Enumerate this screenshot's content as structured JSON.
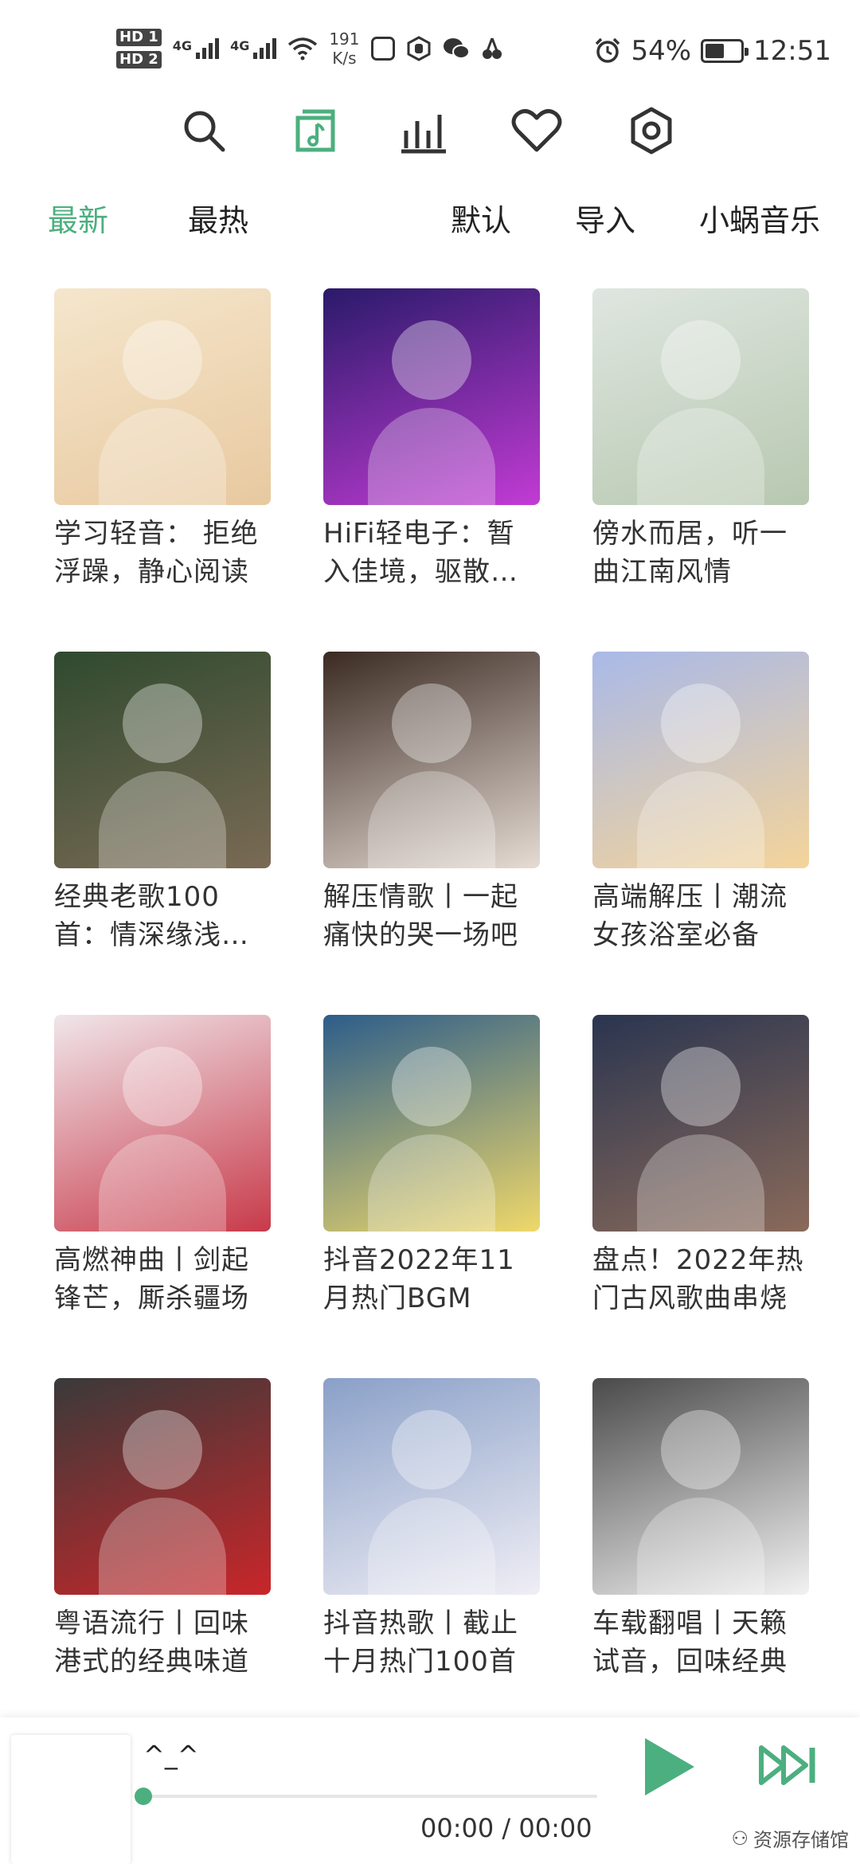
{
  "status_bar": {
    "hd1": "HD 1",
    "hd2": "HD 2",
    "net1": "4G",
    "net2": "4G",
    "speed_value": "191",
    "speed_unit": "K/s",
    "battery": "54%",
    "battery_level": 0.54,
    "time": "12:51"
  },
  "toolbar_icons": [
    "search-icon",
    "music-library-icon",
    "chart-icon",
    "heart-icon",
    "settings-icon"
  ],
  "accent_color": "#4caf7f",
  "tabs": {
    "newest": "最新",
    "hottest": "最热",
    "default": "默认",
    "import": "导入",
    "brand": "小蜗音乐"
  },
  "playlists": [
    {
      "title": "学习轻音： 拒绝浮躁，静心阅读",
      "colors": [
        "#f5e6cc",
        "#e8c9a0"
      ]
    },
    {
      "title": "HiFi轻电子：暂入佳境，驱散…",
      "colors": [
        "#2a1a6a",
        "#c23bd4"
      ]
    },
    {
      "title": "傍水而居，听一曲江南风情",
      "colors": [
        "#dfe6e0",
        "#b7c8b0"
      ]
    },
    {
      "title": "经典老歌100首：情深缘浅…",
      "colors": [
        "#2f4a2f",
        "#7a6a55"
      ]
    },
    {
      "title": "解压情歌丨一起痛快的哭一场吧",
      "colors": [
        "#3a2a22",
        "#e6dcd4"
      ]
    },
    {
      "title": "高端解压丨潮流女孩浴室必备",
      "colors": [
        "#a9b9e8",
        "#f4d49a"
      ]
    },
    {
      "title": "高燃神曲丨剑起锋芒，厮杀疆场",
      "colors": [
        "#f0e6ea",
        "#c83a4a"
      ]
    },
    {
      "title": "抖音2022年11月热门BGM",
      "colors": [
        "#2c5d8a",
        "#efd86a"
      ]
    },
    {
      "title": "盘点！2022年热门古风歌曲串烧",
      "colors": [
        "#2a3550",
        "#8a6a5a"
      ]
    },
    {
      "title": "粤语流行丨回味港式的经典味道",
      "colors": [
        "#3a3a3a",
        "#c8262a"
      ]
    },
    {
      "title": "抖音热歌丨截止十月热门100首",
      "colors": [
        "#8aa0c8",
        "#f0eef5"
      ]
    },
    {
      "title": "车载翻唱丨天籁试音，回味经典",
      "colors": [
        "#4a4a4a",
        "#f2f2f2"
      ]
    }
  ],
  "player": {
    "song": "^_^",
    "time": "00:00 / 00:00",
    "progress": 0
  },
  "watermark": "资源存储馆"
}
